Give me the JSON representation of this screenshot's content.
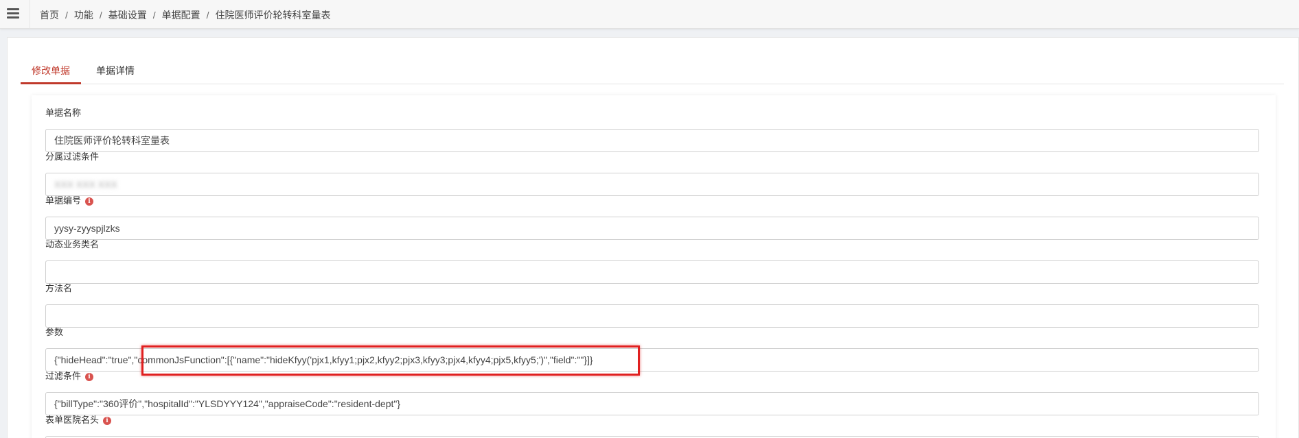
{
  "header": {
    "breadcrumb": [
      "首页",
      "功能",
      "基础设置",
      "单据配置",
      "住院医师评价轮转科室量表"
    ],
    "separator": "/"
  },
  "tabs": [
    {
      "label": "修改单据",
      "active": true
    },
    {
      "label": "单据详情",
      "active": false
    }
  ],
  "form": {
    "bill_name": {
      "label": "单据名称",
      "value": "住院医师评价轮转科室量表"
    },
    "filter_scope": {
      "label": "分属过滤条件",
      "value": "XXX XXX XXX"
    },
    "bill_code": {
      "label": "单据编号",
      "value": "yysy-zyyspjlzks"
    },
    "dynamic_class": {
      "label": "动态业务类名",
      "value": ""
    },
    "method_name": {
      "label": "方法名",
      "value": ""
    },
    "params": {
      "label": "参数",
      "value": "{\"hideHead\":\"true\",\"commonJsFunction\":[{\"name\":\"hideKfyy('pjx1,kfyy1;pjx2,kfyy2;pjx3,kfyy3;pjx4,kfyy4;pjx5,kfyy5;')\",\"field\":\"\"}]}"
    },
    "filter": {
      "label": "过滤条件",
      "value": "{\"billType\":\"360评价\",\"hospitalId\":\"YLSDYYY124\",\"appraiseCode\":\"resident-dept\"}"
    },
    "hospital_header": {
      "label": "表单医院名头",
      "value": ""
    }
  },
  "colors": {
    "accent": "#c0392b",
    "highlight": "#e02020"
  },
  "icons": {
    "menu": "hamburger-icon",
    "info": "info-circle-icon"
  }
}
